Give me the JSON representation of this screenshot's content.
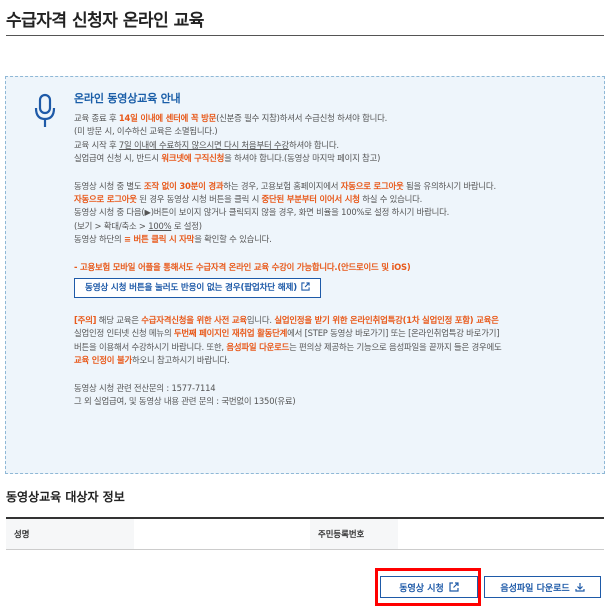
{
  "header": {
    "title": "수급자격 신청자 온라인 교육"
  },
  "notice": {
    "heading": "온라인 동영상교육 안내",
    "p1": {
      "a": "교육 종료 후 ",
      "b": "14일 이내에 센터에 꼭 방문",
      "c": "(신분증 필수 지참)하셔서 수급신청 하셔야 합니다."
    },
    "p2": "(미 방문 시, 이수하신 교육은 소멸됩니다.)",
    "p3": {
      "a": "교육 시작 후 ",
      "b": "7일 이내에 수료하지 않으시면 다시 처음부터 수강",
      "c": "하셔야 합니다."
    },
    "p4": {
      "a": "실업급여 신청 시, 반드시 ",
      "b": "워크넷에 구직신청",
      "c": "을 하셔야 합니다.(동영상 마지막 페이지 참고)"
    },
    "p5": {
      "a": "동영상 시청 중 별도 ",
      "b": "조작 없이 30분이 경과",
      "c": "하는 경우, 고용보험 홈페이지에서 ",
      "d": "자동으로 로그아웃",
      "e": " 됨을 유의하시기 바랍니다."
    },
    "p6": {
      "a": "자동으로 로그아웃",
      "b": " 된 경우 동영상 시청 버튼을 클릭 시 ",
      "c": "중단된 부분부터 이어서 시청",
      "d": " 하실 수 있습니다."
    },
    "p7": "동영상 시청 중 다음(▶)버튼이 보이지 않거나 클릭되지 않을 경우, 화면 비율을 100%로 설정 하시기 바랍니다.",
    "p8": {
      "a": "(보기 > 확대/축소 > ",
      "b": "100%",
      "c": " 로 설정)"
    },
    "p9": {
      "a": "동영상 하단의 ",
      "b": "≡ 버튼 클릭 시 자막",
      "c": "을 확인할 수 있습니다."
    },
    "mobile_note": "- 고용보험 모바일 어플을 통해서도 수급자격 온라인 교육 수강이 가능합니다.(안드로이드 및 iOS)",
    "popup_button": "동영상 시청 버튼을 눌러도 반응이 없는 경우(팝업차단 해제)",
    "p10": {
      "a": "[주의]",
      "b": " 해당 교육은 ",
      "c": "수급자격신청을 위한 사전 교육",
      "d": "입니다. ",
      "e": "실업인정을 받기 위한 온라인취업특강(1차 실업인정 포함) 교육은"
    },
    "p11": {
      "a": "실업인정 인터넷 신청 메뉴의 ",
      "b": "두번째 페이지인 재취업 활동단계",
      "c": "에서 [STEP 동영상 바로가기] 또는 [온라인취업특강 바로가기]"
    },
    "p12": {
      "a": "버튼을 이용해서 수강하시기 바랍니다. 또한, ",
      "b": "음성파일 다운로드",
      "c": "는 편의상 제공하는 기능으로 음성파일을 끝까지 들은 경우에도"
    },
    "p13": {
      "a": "교육 인정이 불가",
      "b": "하오니 참고하시기 바랍니다."
    },
    "contact1": "동영상 시청 관련 전산문의 : 1577-7114",
    "contact2": "그 외 실업급여, 및 동영상 내용 관련 문의 : 국번없이 1350(유료)"
  },
  "target_info": {
    "title": "동영상교육 대상자 정보",
    "name_label": "성명",
    "id_label": "주민등록번호"
  },
  "actions": {
    "watch_video": "동영상 시청",
    "download_audio": "음성파일 다운로드"
  },
  "colors": {
    "accent_blue": "#1e5aa8",
    "highlight_orange": "#e8591a",
    "annotation_red": "#ff0000"
  }
}
